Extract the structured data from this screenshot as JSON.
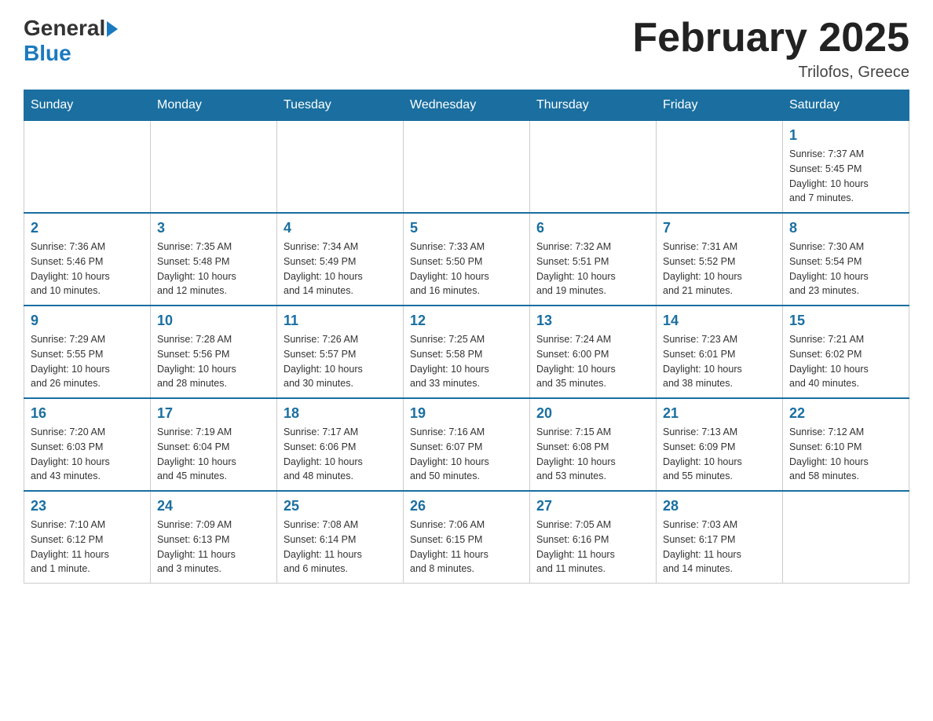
{
  "header": {
    "logo_general": "General",
    "logo_blue": "Blue",
    "month_title": "February 2025",
    "location": "Trilofos, Greece"
  },
  "days_of_week": [
    "Sunday",
    "Monday",
    "Tuesday",
    "Wednesday",
    "Thursday",
    "Friday",
    "Saturday"
  ],
  "weeks": [
    [
      {
        "num": "",
        "info": ""
      },
      {
        "num": "",
        "info": ""
      },
      {
        "num": "",
        "info": ""
      },
      {
        "num": "",
        "info": ""
      },
      {
        "num": "",
        "info": ""
      },
      {
        "num": "",
        "info": ""
      },
      {
        "num": "1",
        "info": "Sunrise: 7:37 AM\nSunset: 5:45 PM\nDaylight: 10 hours\nand 7 minutes."
      }
    ],
    [
      {
        "num": "2",
        "info": "Sunrise: 7:36 AM\nSunset: 5:46 PM\nDaylight: 10 hours\nand 10 minutes."
      },
      {
        "num": "3",
        "info": "Sunrise: 7:35 AM\nSunset: 5:48 PM\nDaylight: 10 hours\nand 12 minutes."
      },
      {
        "num": "4",
        "info": "Sunrise: 7:34 AM\nSunset: 5:49 PM\nDaylight: 10 hours\nand 14 minutes."
      },
      {
        "num": "5",
        "info": "Sunrise: 7:33 AM\nSunset: 5:50 PM\nDaylight: 10 hours\nand 16 minutes."
      },
      {
        "num": "6",
        "info": "Sunrise: 7:32 AM\nSunset: 5:51 PM\nDaylight: 10 hours\nand 19 minutes."
      },
      {
        "num": "7",
        "info": "Sunrise: 7:31 AM\nSunset: 5:52 PM\nDaylight: 10 hours\nand 21 minutes."
      },
      {
        "num": "8",
        "info": "Sunrise: 7:30 AM\nSunset: 5:54 PM\nDaylight: 10 hours\nand 23 minutes."
      }
    ],
    [
      {
        "num": "9",
        "info": "Sunrise: 7:29 AM\nSunset: 5:55 PM\nDaylight: 10 hours\nand 26 minutes."
      },
      {
        "num": "10",
        "info": "Sunrise: 7:28 AM\nSunset: 5:56 PM\nDaylight: 10 hours\nand 28 minutes."
      },
      {
        "num": "11",
        "info": "Sunrise: 7:26 AM\nSunset: 5:57 PM\nDaylight: 10 hours\nand 30 minutes."
      },
      {
        "num": "12",
        "info": "Sunrise: 7:25 AM\nSunset: 5:58 PM\nDaylight: 10 hours\nand 33 minutes."
      },
      {
        "num": "13",
        "info": "Sunrise: 7:24 AM\nSunset: 6:00 PM\nDaylight: 10 hours\nand 35 minutes."
      },
      {
        "num": "14",
        "info": "Sunrise: 7:23 AM\nSunset: 6:01 PM\nDaylight: 10 hours\nand 38 minutes."
      },
      {
        "num": "15",
        "info": "Sunrise: 7:21 AM\nSunset: 6:02 PM\nDaylight: 10 hours\nand 40 minutes."
      }
    ],
    [
      {
        "num": "16",
        "info": "Sunrise: 7:20 AM\nSunset: 6:03 PM\nDaylight: 10 hours\nand 43 minutes."
      },
      {
        "num": "17",
        "info": "Sunrise: 7:19 AM\nSunset: 6:04 PM\nDaylight: 10 hours\nand 45 minutes."
      },
      {
        "num": "18",
        "info": "Sunrise: 7:17 AM\nSunset: 6:06 PM\nDaylight: 10 hours\nand 48 minutes."
      },
      {
        "num": "19",
        "info": "Sunrise: 7:16 AM\nSunset: 6:07 PM\nDaylight: 10 hours\nand 50 minutes."
      },
      {
        "num": "20",
        "info": "Sunrise: 7:15 AM\nSunset: 6:08 PM\nDaylight: 10 hours\nand 53 minutes."
      },
      {
        "num": "21",
        "info": "Sunrise: 7:13 AM\nSunset: 6:09 PM\nDaylight: 10 hours\nand 55 minutes."
      },
      {
        "num": "22",
        "info": "Sunrise: 7:12 AM\nSunset: 6:10 PM\nDaylight: 10 hours\nand 58 minutes."
      }
    ],
    [
      {
        "num": "23",
        "info": "Sunrise: 7:10 AM\nSunset: 6:12 PM\nDaylight: 11 hours\nand 1 minute."
      },
      {
        "num": "24",
        "info": "Sunrise: 7:09 AM\nSunset: 6:13 PM\nDaylight: 11 hours\nand 3 minutes."
      },
      {
        "num": "25",
        "info": "Sunrise: 7:08 AM\nSunset: 6:14 PM\nDaylight: 11 hours\nand 6 minutes."
      },
      {
        "num": "26",
        "info": "Sunrise: 7:06 AM\nSunset: 6:15 PM\nDaylight: 11 hours\nand 8 minutes."
      },
      {
        "num": "27",
        "info": "Sunrise: 7:05 AM\nSunset: 6:16 PM\nDaylight: 11 hours\nand 11 minutes."
      },
      {
        "num": "28",
        "info": "Sunrise: 7:03 AM\nSunset: 6:17 PM\nDaylight: 11 hours\nand 14 minutes."
      },
      {
        "num": "",
        "info": ""
      }
    ]
  ]
}
